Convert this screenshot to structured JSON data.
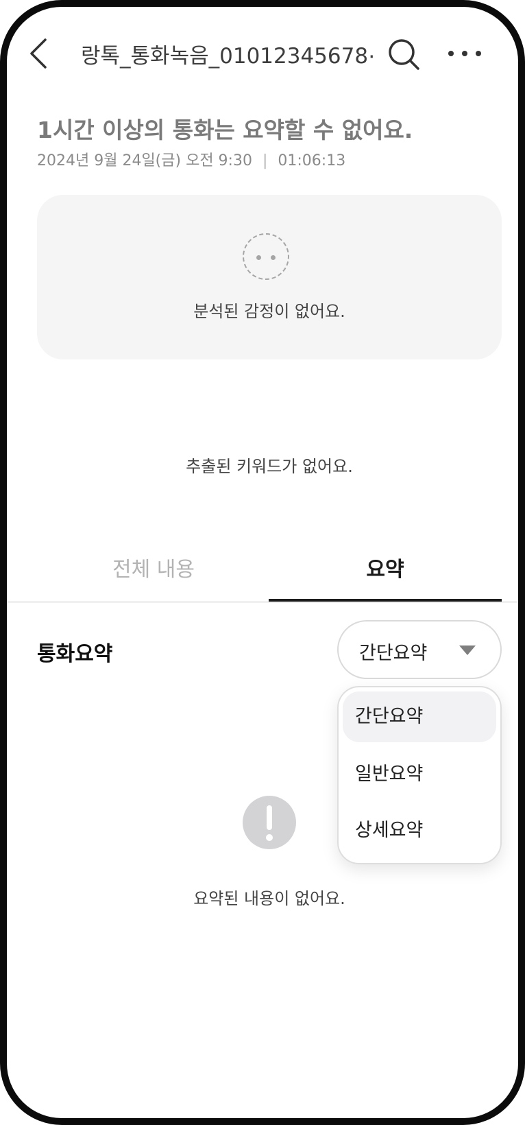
{
  "header": {
    "title": "랑톡_통화녹음_01012345678⋯",
    "back_icon": "chevron-left-icon",
    "search_icon": "search-icon",
    "more_icon": "more-horizontal-icon"
  },
  "call": {
    "headline": "1시간 이상의 통화는 요약할 수 없어요.",
    "datetime": "2024년 9월 24일(금) 오전 9:30",
    "separator": "|",
    "duration": "01:06:13"
  },
  "emotion": {
    "icon": "face-icon",
    "empty_text": "분석된 감정이 없어요."
  },
  "keywords": {
    "empty_text": "추출된 키워드가 없어요."
  },
  "tabs": [
    {
      "label": "전체 내용",
      "active": false
    },
    {
      "label": "요약",
      "active": true
    }
  ],
  "summary": {
    "section_title": "통화요약",
    "select": {
      "value": "간단요약",
      "icon": "caret-down-icon"
    },
    "options": [
      {
        "label": "간단요약",
        "selected": true
      },
      {
        "label": "일반요약",
        "selected": false
      },
      {
        "label": "상세요약",
        "selected": false
      }
    ],
    "empty_icon": "alert-icon",
    "empty_text": "요약된 내용이 없어요."
  },
  "colors": {
    "active_tab": "#1b1b1b",
    "inactive_tab": "#b3b3b3",
    "card_bg": "#f5f5f5"
  }
}
